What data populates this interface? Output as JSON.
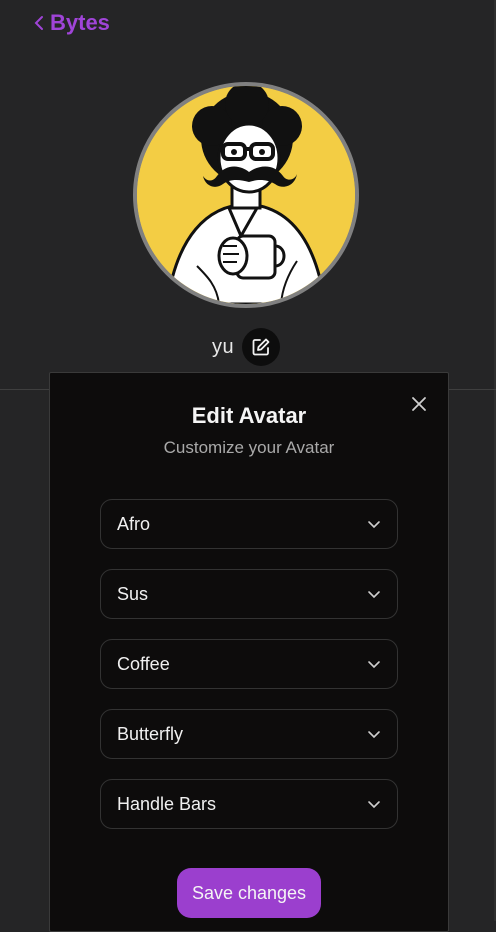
{
  "header": {
    "back_label": "Bytes",
    "accent": "#a044d8"
  },
  "profile": {
    "username": "yu",
    "avatar_bg": "#f3cd44"
  },
  "modal": {
    "title": "Edit Avatar",
    "subtitle": "Customize your Avatar",
    "selects": [
      {
        "value": "Afro"
      },
      {
        "value": "Sus"
      },
      {
        "value": "Coffee"
      },
      {
        "value": "Butterfly"
      },
      {
        "value": "Handle Bars"
      }
    ],
    "save_label": "Save changes"
  },
  "icons": {
    "back": "chevron-left-icon",
    "edit": "pencil-square-icon",
    "close": "close-icon",
    "dropdown": "chevron-down-icon"
  }
}
